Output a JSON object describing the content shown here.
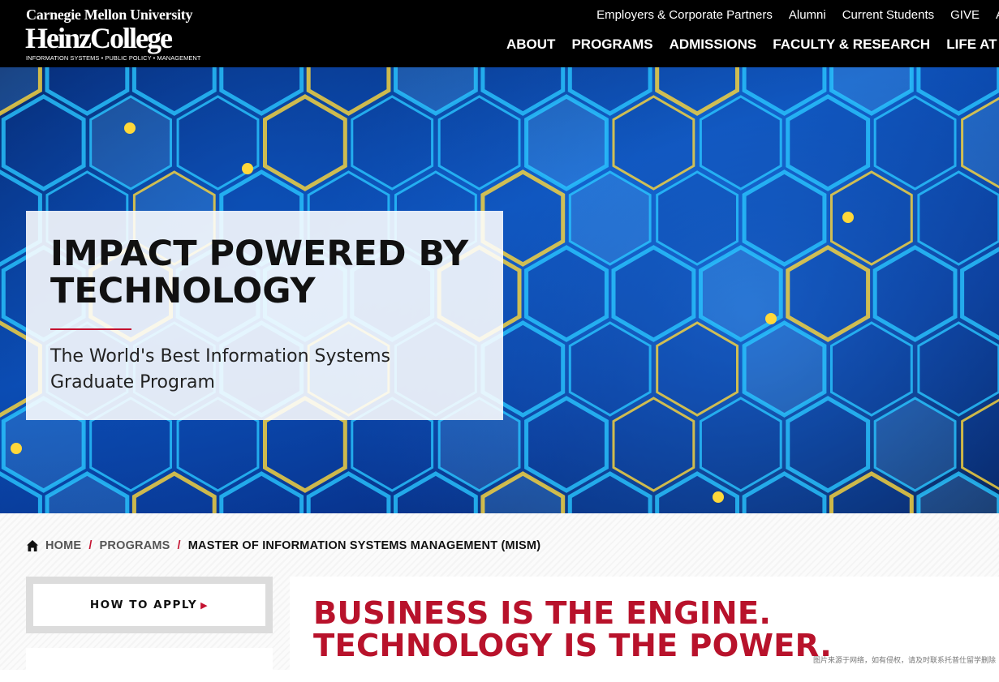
{
  "header": {
    "logo": {
      "university": "Carnegie Mellon University",
      "college": "HeinzCollege",
      "tagline": "INFORMATION SYSTEMS • PUBLIC POLICY • MANAGEMENT"
    },
    "utility_nav": [
      "Employers & Corporate Partners",
      "Alumni",
      "Current Students",
      "GIVE",
      "A"
    ],
    "main_nav": [
      "ABOUT",
      "PROGRAMS",
      "ADMISSIONS",
      "FACULTY & RESEARCH",
      "LIFE AT HEINZ"
    ]
  },
  "hero": {
    "title": "IMPACT POWERED BY TECHNOLOGY",
    "subtitle": "The World's Best Information Systems Graduate Program"
  },
  "breadcrumb": {
    "home": "HOME",
    "separator": "/",
    "items": [
      "PROGRAMS"
    ],
    "current": "MASTER OF INFORMATION SYSTEMS MANAGEMENT (MISM)"
  },
  "sidebar": {
    "apply_label": "HOW TO APPLY",
    "apply_arrow": "▶"
  },
  "main": {
    "headline": "BUSINESS IS THE ENGINE. TECHNOLOGY IS THE POWER."
  },
  "watermark": "图片来源于网络，如有侵权，请及时联系托普仕留学删除",
  "colors": {
    "header_bg": "#000000",
    "accent_red": "#c41230",
    "headline_red": "#b8122b",
    "hero_blue": "#0a4fb5",
    "hex_cyan": "#29c6ff",
    "glow_yellow": "#ffd83a"
  },
  "icons": {
    "home": "home-icon",
    "apply_arrow": "triangle-right-icon"
  }
}
